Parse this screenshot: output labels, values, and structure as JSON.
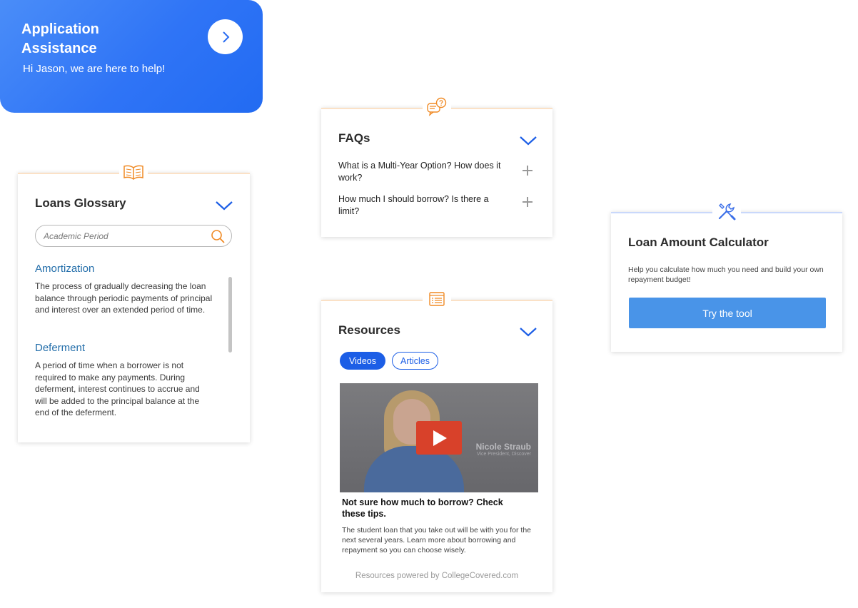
{
  "assist": {
    "title": "Application Assistance",
    "subtitle": "Hi Jason, we are here to help!",
    "gradient": [
      "#4a8df8",
      "#226bf2"
    ]
  },
  "glossary": {
    "title": "Loans Glossary",
    "icon": "open-book-icon",
    "search": {
      "placeholder": "Academic Period",
      "value": ""
    },
    "terms": [
      {
        "term": "Amortization",
        "definition": "The process of gradually decreasing the loan balance through periodic payments of principal and interest over an extended period of time."
      },
      {
        "term": "Deferment",
        "definition": "A period of time when a borrower is not required to make any payments. During deferment, interest continues to accrue and will be added to the principal balance at the end of the deferment."
      }
    ]
  },
  "faq": {
    "title": "FAQs",
    "icon": "question-chat-icon",
    "questions": [
      {
        "text": "What is a Multi-Year Option? How does it work?"
      },
      {
        "text": "How much I should borrow? Is there a limit?"
      }
    ]
  },
  "resources": {
    "title": "Resources",
    "icon": "list-document-icon",
    "tabs": [
      {
        "label": "Videos",
        "active": true
      },
      {
        "label": "Articles",
        "active": false
      }
    ],
    "video": {
      "speaker_name": "Nicole Straub",
      "speaker_role": "Vice President, Discover",
      "title": "Not sure how much to borrow? Check these tips.",
      "description": "The student loan that you take out will be with you for the next several years. Learn more about borrowing and repayment so you can choose wisely."
    },
    "footer": "Resources powered by CollegeCovered.com"
  },
  "calculator": {
    "title": "Loan Amount Calculator",
    "icon": "wrench-screwdriver-icon",
    "description": "Help you calculate how much you need and build your own repayment budget!",
    "button_label": "Try the tool"
  },
  "colors": {
    "accent_blue": "#1c5ee6",
    "orange": "#f08a24",
    "term_blue": "#236eaa",
    "button_blue": "#4994e8"
  }
}
